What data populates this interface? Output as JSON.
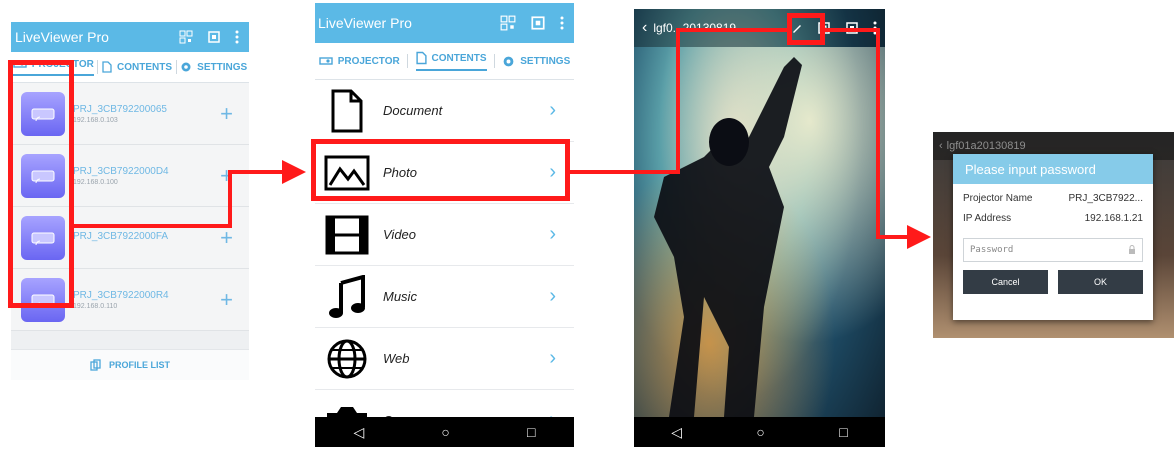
{
  "brand_color": "#5bb9e6",
  "highlight_color": "#ff1a1a",
  "screen1": {
    "app_title": "LiveViewer Pro",
    "tabs": [
      "PROJECTOR",
      "CONTENTS",
      "SETTINGS"
    ],
    "projectors": [
      {
        "name": "PRJ_3CB792200065",
        "ip": "192.168.0.103"
      },
      {
        "name": "PRJ_3CB7922000D4",
        "ip": "192.168.0.100"
      },
      {
        "name": "PRJ_3CB7922000FA",
        "ip": ""
      },
      {
        "name": "PRJ_3CB7922000R4",
        "ip": "192.168.0.110"
      }
    ],
    "footer_label": "PROFILE LIST"
  },
  "screen2": {
    "app_title": "LiveViewer Pro",
    "tabs": [
      "PROJECTOR",
      "CONTENTS",
      "SETTINGS"
    ],
    "menu": [
      {
        "label": "Document",
        "icon": "document-icon"
      },
      {
        "label": "Photo",
        "icon": "photo-icon"
      },
      {
        "label": "Video",
        "icon": "video-icon"
      },
      {
        "label": "Music",
        "icon": "music-icon"
      },
      {
        "label": "Web",
        "icon": "globe-icon"
      },
      {
        "label": "Camera",
        "icon": "camera-icon"
      }
    ]
  },
  "screen3": {
    "title": "lgf0...20130819...",
    "back_symbol": "‹"
  },
  "screen4": {
    "topbar_title": "lgf01a20130819",
    "dialog_title": "Please input password",
    "projector_name_label": "Projector Name",
    "projector_name_value": "PRJ_3CB7922...",
    "ip_label": "IP Address",
    "ip_value": "192.168.1.21",
    "password_placeholder": "Password",
    "cancel_label": "Cancel",
    "ok_label": "OK"
  }
}
